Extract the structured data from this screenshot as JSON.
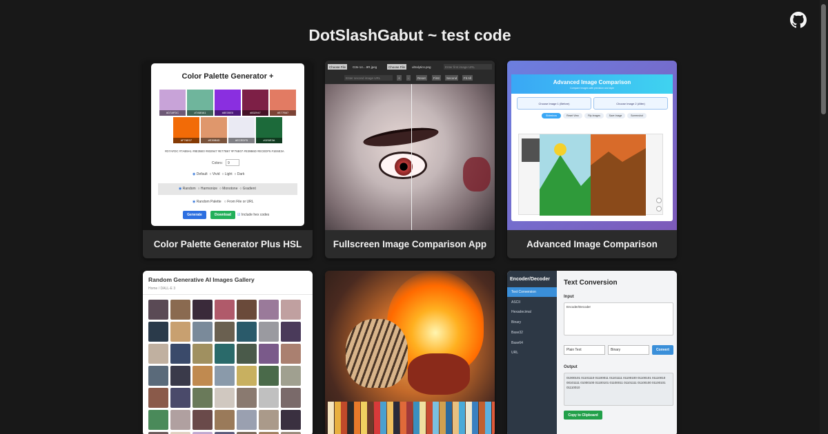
{
  "page": {
    "title": "DotSlashGabut ~ test code",
    "github_icon": "github-icon"
  },
  "cards": [
    {
      "caption": "Color Palette Generator Plus HSL"
    },
    {
      "caption": "Fullscreen Image Comparison App"
    },
    {
      "caption": "Advanced Image Comparison"
    },
    {
      "caption": ""
    },
    {
      "caption": ""
    },
    {
      "caption": ""
    }
  ],
  "palette_thumb": {
    "title": "Color Palette Generator +",
    "swatches": [
      {
        "hex": "#D7AFDC",
        "color": "#c8a3d8"
      },
      {
        "hex": "#7AB9A1",
        "color": "#6fb59c"
      },
      {
        "hex": "#8E35E0",
        "color": "#8a2fe0"
      },
      {
        "hex": "#832947",
        "color": "#7d1f46"
      },
      {
        "hex": "#E77B67",
        "color": "#e27b63"
      },
      {
        "hex": "#F76E07",
        "color": "#f26b07"
      },
      {
        "hex": "#E39B6D",
        "color": "#df976c"
      },
      {
        "hex": "#ECEDF5",
        "color": "#eaeaf3"
      },
      {
        "hex": "#1E6E3A",
        "color": "#1c6a3a"
      }
    ],
    "hex_line": "#D7AFDC #7AB9A1 #8E35E0 #832947 #E77B67 #F76E07 #E39B6D #ECEDF5 #1E6E3A",
    "colors_label": "Colors:",
    "colors_value": "9",
    "modes": [
      "Default",
      "Vivid",
      "Light",
      "Dark"
    ],
    "types": [
      "Random",
      "Harmonize",
      "Monotone",
      "Gradient"
    ],
    "sources": [
      "Random Palette",
      "From File or URL"
    ],
    "generate": "Generate",
    "download": "Download",
    "include_hex": "Include hex codes"
  },
  "compare_thumb": {
    "choose_file": "Choose File",
    "file1": "G3s-14....9R.jpeg",
    "file2": "ultralytics.png",
    "url_placeholder": "Enter first image URL",
    "url2_placeholder": "Enter second image URL",
    "buttons": [
      "+",
      "-",
      "Reset",
      "First",
      "Second",
      "Fit All"
    ]
  },
  "advanced_thumb": {
    "title": "Advanced Image Comparison",
    "subtitle": "Compare images with precision and style",
    "choose1": "Choose Image 1 (Before)",
    "choose2": "Choose Image 2 (After)",
    "actions": [
      "Slideshow",
      "Reset View",
      "Flip Images",
      "Save Image",
      "Screenshot"
    ]
  },
  "gallery_thumb": {
    "title": "Random Generative AI Images Gallery",
    "breadcrumb": "Home / DALL-E 3"
  },
  "encoder_thumb": {
    "sidebar_title": "Encoder/Decoder",
    "sidebar_items": [
      "Text Conversion",
      "ASCII",
      "Hexadecimal",
      "Binary",
      "Base32",
      "Base64",
      "URL"
    ],
    "main_title": "Text Conversion",
    "input_label": "Input",
    "input_value": "Encoder/Decoder",
    "from_select": "Plain Text",
    "to_select": "Binary",
    "convert": "Convert",
    "output_label": "Output",
    "output_value": "01000101 01101110 01100011 01101111 01100100 01100101 01110010 00101111 01000100 01100101 01100011 01101111 01100100 01100101 01110010",
    "copy": "Copy to Clipboard"
  }
}
